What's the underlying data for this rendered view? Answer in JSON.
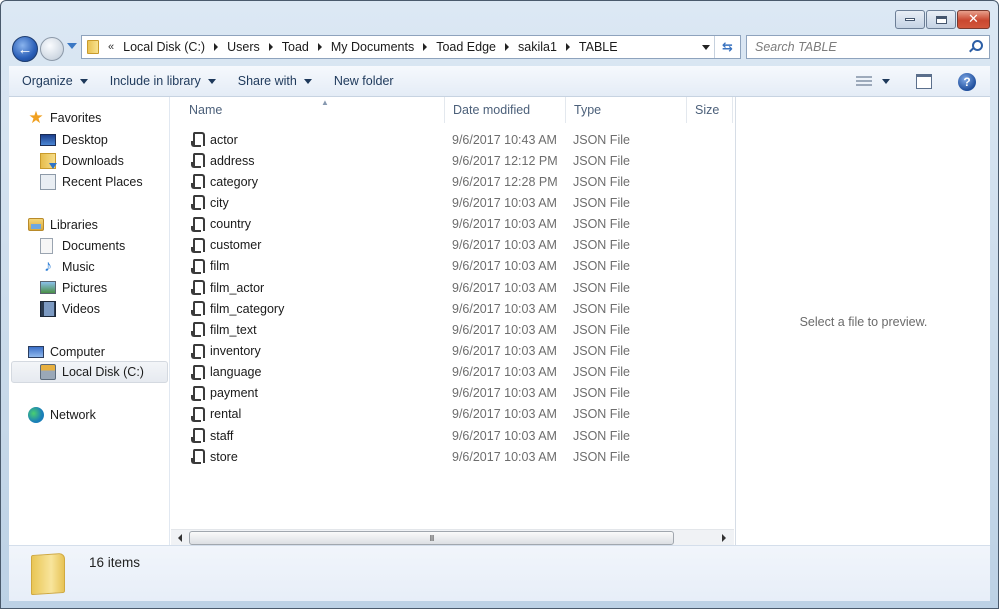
{
  "window": {
    "caption_buttons": [
      "minimize",
      "maximize",
      "close"
    ]
  },
  "navigation": {
    "back_icon": "back-arrow-icon",
    "forward_icon": "forward-arrow-icon",
    "recent_pages_icon": "chevron-down-icon",
    "overflow_chevron": "«",
    "breadcrumb": [
      "Local Disk (C:)",
      "Users",
      "Toad",
      "My Documents",
      "Toad Edge",
      "sakila1",
      "TABLE"
    ],
    "refresh_icon": "refresh-icon"
  },
  "search": {
    "placeholder": "Search TABLE",
    "value": ""
  },
  "toolbar": {
    "organize": "Organize",
    "include_in_library": "Include in library",
    "share_with": "Share with",
    "new_folder": "New folder",
    "views_icon": "details-view-icon",
    "preview_pane_icon": "preview-pane-icon",
    "help_icon": "help-icon",
    "help_glyph": "?"
  },
  "sidebar": {
    "favorites": {
      "label": "Favorites",
      "items": [
        {
          "label": "Desktop",
          "icon": "desktop-icon"
        },
        {
          "label": "Downloads",
          "icon": "downloads-icon"
        },
        {
          "label": "Recent Places",
          "icon": "recent-places-icon"
        }
      ]
    },
    "libraries": {
      "label": "Libraries",
      "items": [
        {
          "label": "Documents",
          "icon": "documents-icon"
        },
        {
          "label": "Music",
          "icon": "music-icon"
        },
        {
          "label": "Pictures",
          "icon": "pictures-icon"
        },
        {
          "label": "Videos",
          "icon": "videos-icon"
        }
      ]
    },
    "computer": {
      "label": "Computer",
      "items": [
        {
          "label": "Local Disk (C:)",
          "icon": "local-disk-icon",
          "selected": true
        }
      ]
    },
    "network": {
      "label": "Network"
    }
  },
  "filelist": {
    "columns": {
      "name": "Name",
      "date": "Date modified",
      "type": "Type",
      "size": "Size"
    },
    "sorted_by": "Name",
    "files": [
      {
        "name": "actor",
        "date": "9/6/2017 10:43 AM",
        "type": "JSON File"
      },
      {
        "name": "address",
        "date": "9/6/2017 12:12 PM",
        "type": "JSON File"
      },
      {
        "name": "category",
        "date": "9/6/2017 12:28 PM",
        "type": "JSON File"
      },
      {
        "name": "city",
        "date": "9/6/2017 10:03 AM",
        "type": "JSON File"
      },
      {
        "name": "country",
        "date": "9/6/2017 10:03 AM",
        "type": "JSON File"
      },
      {
        "name": "customer",
        "date": "9/6/2017 10:03 AM",
        "type": "JSON File"
      },
      {
        "name": "film",
        "date": "9/6/2017 10:03 AM",
        "type": "JSON File"
      },
      {
        "name": "film_actor",
        "date": "9/6/2017 10:03 AM",
        "type": "JSON File"
      },
      {
        "name": "film_category",
        "date": "9/6/2017 10:03 AM",
        "type": "JSON File"
      },
      {
        "name": "film_text",
        "date": "9/6/2017 10:03 AM",
        "type": "JSON File"
      },
      {
        "name": "inventory",
        "date": "9/6/2017 10:03 AM",
        "type": "JSON File"
      },
      {
        "name": "language",
        "date": "9/6/2017 10:03 AM",
        "type": "JSON File"
      },
      {
        "name": "payment",
        "date": "9/6/2017 10:03 AM",
        "type": "JSON File"
      },
      {
        "name": "rental",
        "date": "9/6/2017 10:03 AM",
        "type": "JSON File"
      },
      {
        "name": "staff",
        "date": "9/6/2017 10:03 AM",
        "type": "JSON File"
      },
      {
        "name": "store",
        "date": "9/6/2017 10:03 AM",
        "type": "JSON File"
      }
    ],
    "scrollbar_grip": "III"
  },
  "preview": {
    "message": "Select a file to preview."
  },
  "status": {
    "item_count": "16 items"
  }
}
